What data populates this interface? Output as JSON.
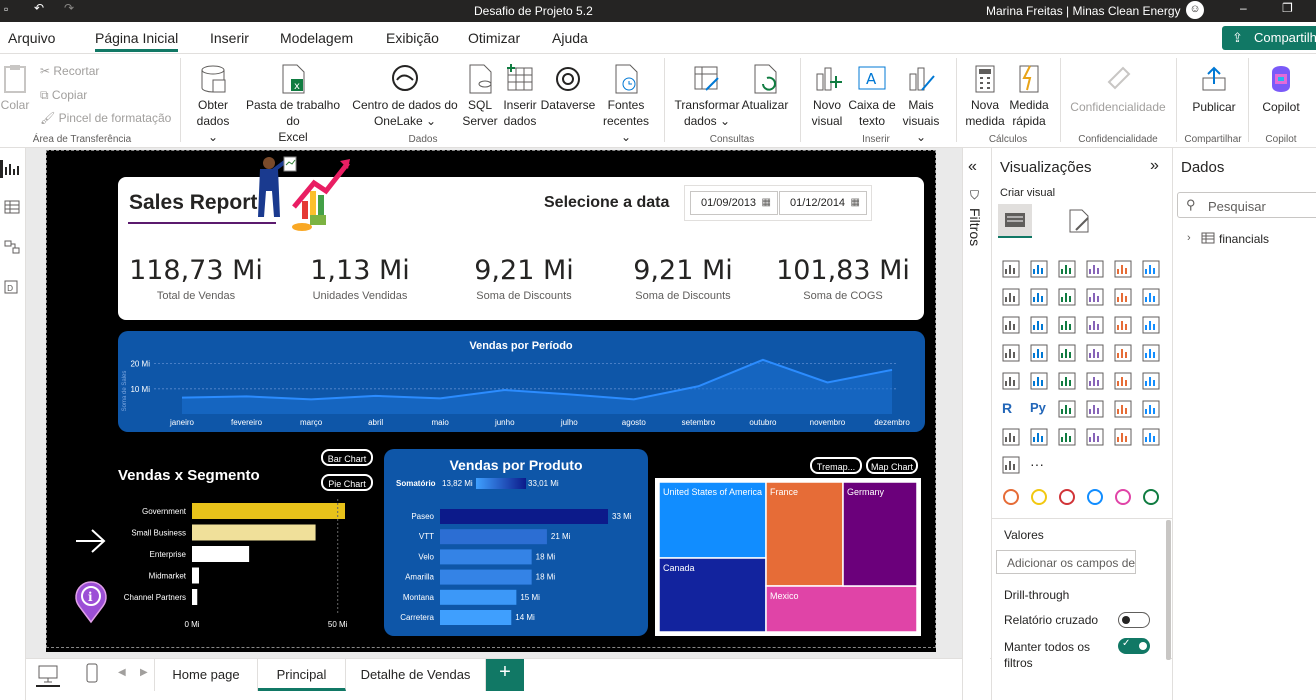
{
  "window": {
    "title": "Desafio de Projeto 5.2",
    "user": "Marina Freitas | Minas Clean Energy"
  },
  "menu": {
    "items": [
      "Arquivo",
      "Página Inicial",
      "Inserir",
      "Modelagem",
      "Exibição",
      "Otimizar",
      "Ajuda"
    ],
    "active": "Página Inicial",
    "share": "Compartilhar"
  },
  "ribbon": {
    "colar": "Colar",
    "recortar": "Recortar",
    "copiar": "Copiar",
    "pincel": "Pincel de formatação",
    "obter1": "Obter",
    "obter2": "dados ⌄",
    "excel1": "Pasta de trabalho do",
    "excel2": "Excel",
    "onelake1": "Centro de dados do",
    "onelake2": "OneLake ⌄",
    "sql1": "SQL",
    "sql2": "Server",
    "inserir1": "Inserir",
    "inserir2": "dados",
    "dataverse": "Dataverse",
    "fontes1": "Fontes",
    "fontes2": "recentes ⌄",
    "transf1": "Transformar",
    "transf2": "dados ⌄",
    "atualizar": "Atualizar",
    "novo1": "Novo",
    "novo2": "visual",
    "caixa1": "Caixa de",
    "caixa2": "texto",
    "mais1": "Mais",
    "mais2": "visuais ⌄",
    "medida1": "Nova",
    "medida2": "medida",
    "rapida1": "Medida",
    "rapida2": "rápida",
    "confid": "Confidencialidade",
    "publicar": "Publicar",
    "copilot": "Copilot",
    "groups": {
      "area": "Área de Transferência",
      "dados": "Dados",
      "consultas": "Consultas",
      "inserir": "Inserir",
      "calculos": "Cálculos",
      "confid": "Confidencialidade",
      "compartilhar": "Compartilhar",
      "copilot": "Copilot"
    }
  },
  "report": {
    "title": "Sales Report",
    "date_label": "Selecione a data",
    "date_start": "01/09/2013",
    "date_end": "01/12/2014",
    "kpis": [
      {
        "value": "118,73 Mi",
        "label": "Total de Vendas"
      },
      {
        "value": "1,13 Mi",
        "label": "Unidades Vendidas"
      },
      {
        "value": "9,21 Mi",
        "label": "Soma de Discounts"
      },
      {
        "value": "9,21 Mi",
        "label": "Soma de Discounts"
      },
      {
        "value": "101,83 Mi",
        "label": "Soma de COGS"
      }
    ],
    "buttons": {
      "bar": "Bar Chart",
      "pie": "Pie Chart",
      "treemap": "Tremap...",
      "map": "Map Chart"
    }
  },
  "chart_data": [
    {
      "type": "area",
      "title": "Vendas por Período",
      "ylabel": "Soma de Sales",
      "categories": [
        "janeiro",
        "fevereiro",
        "março",
        "abril",
        "maio",
        "junho",
        "julho",
        "agosto",
        "setembro",
        "outubro",
        "novembro",
        "dezembro"
      ],
      "values": [
        6.5,
        7.0,
        5.8,
        7.2,
        6.2,
        9.5,
        7.8,
        5.8,
        11.0,
        21.5,
        12.5,
        17.5
      ],
      "yticks": [
        "10 Mi",
        "20 Mi"
      ],
      "ylim": [
        0,
        25
      ]
    },
    {
      "type": "bar",
      "title": "Vendas x Segmento",
      "categories": [
        "Government",
        "Small Business",
        "Enterprise",
        "Midmarket",
        "Channel Partners"
      ],
      "values": [
        52.5,
        42.4,
        19.6,
        2.4,
        1.8
      ],
      "colors": [
        "#e8c21a",
        "#f0e09a",
        "#ffffff",
        "#ffffff",
        "#ffffff"
      ],
      "xticks": [
        "0 Mi",
        "50 Mi"
      ],
      "xlim": [
        0,
        50
      ]
    },
    {
      "type": "bar",
      "title": "Vendas por Produto",
      "legend": {
        "label": "Somatório",
        "min": "13,82 Mi",
        "max": "33,01 Mi"
      },
      "categories": [
        "Paseo",
        "VTT",
        "Velo",
        "Amarilla",
        "Montana",
        "Carretera"
      ],
      "values": [
        33,
        21,
        18,
        18,
        15,
        14
      ],
      "labels": [
        "33 Mi",
        "21 Mi",
        "18 Mi",
        "18 Mi",
        "15 Mi",
        "14 Mi"
      ],
      "xlim": [
        0,
        33
      ]
    },
    {
      "type": "heatmap",
      "title": "Treemap",
      "categories": [
        "United States of America",
        "Canada",
        "France",
        "Mexico",
        "Germany"
      ],
      "colors": [
        "#118dff",
        "#12239e",
        "#e66c37",
        "#e044a7",
        "#6b007b"
      ]
    }
  ],
  "tabs": [
    "Home page",
    "Principal",
    "Detalhe de Vendas"
  ],
  "active_tab": "Principal",
  "filtros": "Filtros",
  "viz": {
    "title": "Visualizações",
    "criar": "Criar visual",
    "valores": "Valores",
    "add": "Adicionar os campos de da...",
    "drill": "Drill-through",
    "cruzado": "Relatório cruzado",
    "manter1": "Manter todos os",
    "manter2": "filtros"
  },
  "dados": {
    "title": "Dados",
    "search": "Pesquisar",
    "table": "financials"
  }
}
